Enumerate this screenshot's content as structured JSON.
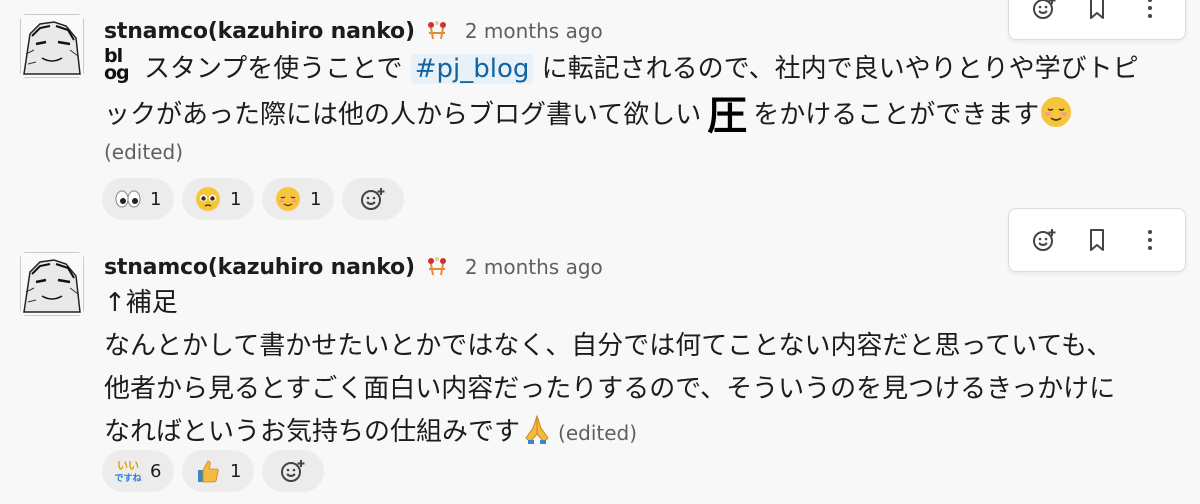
{
  "messages": [
    {
      "sender": "stnamco(kazuhiro nanko)",
      "status_emoji": "boxing-emoji",
      "timestamp": "2 months ago",
      "blog_emoji": {
        "top": "bl",
        "bottom": "og"
      },
      "line1_text": "スタンプを使うことで",
      "channel": "#pj_blog",
      "line1_rest": "に転記されるので、社内で良いやりとりや学びトピ",
      "line2_text": "ックがあった際には他の人からブログ書いて欲しい",
      "pressure_emoji": "圧",
      "line2_rest": "をかけることができます",
      "edited": "(edited)",
      "reactions": [
        {
          "emoji": "eyes-emoji",
          "count": "1"
        },
        {
          "emoji": "pleading-face-emoji",
          "count": "1"
        },
        {
          "emoji": "relieved-smile-emoji",
          "count": "1"
        }
      ]
    },
    {
      "sender": "stnamco(kazuhiro nanko)",
      "status_emoji": "boxing-emoji",
      "timestamp": "2 months ago",
      "lines": [
        "↑補足",
        "なんとかして書かせたいとかではなく、自分では何てことない内容だと思っていても、",
        "他者から見るとすごく面白い内容だったりするので、そういうのを見つけるきっかけに",
        "なればというお気持ちの仕組みです"
      ],
      "edited": "(edited)",
      "reactions": [
        {
          "emoji": "iine-desune-emoji",
          "label": "いい ですね",
          "count": "6"
        },
        {
          "emoji": "thumbs-up-emoji",
          "count": "1"
        }
      ]
    }
  ],
  "toolbar_icons": [
    "add-reaction-icon",
    "bookmark-icon",
    "more-actions-icon"
  ],
  "colors": {
    "background": "#f8f8f8",
    "channel_link": "#1264a3",
    "channel_bg": "#e8f1f8",
    "muted_text": "#616061",
    "reaction_bg": "#ececec"
  }
}
